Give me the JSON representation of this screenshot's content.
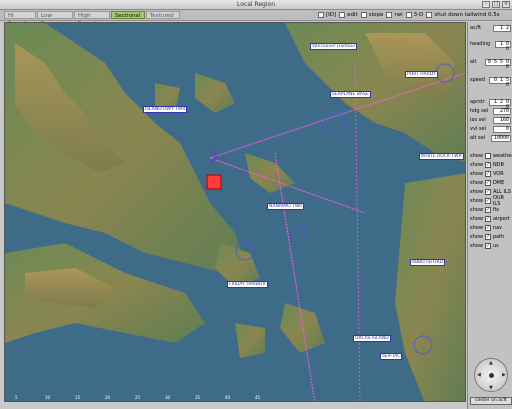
{
  "window": {
    "title": "Local Region"
  },
  "tabs": [
    {
      "label": "Hi Speed"
    },
    {
      "label": "Low Enroute"
    },
    {
      "label": "High Enroute"
    },
    {
      "label": "Sectional",
      "active": true
    },
    {
      "label": "Textured"
    }
  ],
  "toolbar_options": [
    {
      "label": "[ID]",
      "checked": false
    },
    {
      "label": "edit",
      "checked": false
    },
    {
      "label": "slope",
      "checked": false
    },
    {
      "label": "rwi",
      "checked": false
    },
    {
      "label": "3-D",
      "checked": false
    },
    {
      "label": "shut down tailwind 0.5s",
      "checked": false
    }
  ],
  "panel": {
    "zoom_label": "ac/ft",
    "zoom_value": "1 2",
    "heading_label": "heading",
    "heading_value": "1 0 0",
    "alt_label": "alt",
    "alt_value": "0 5 5 0 0",
    "speed_label": "speed",
    "speed_value": "0 1 5 0",
    "aprstr_label": "aprstr",
    "aprstr_value": "1 2 0 0",
    "hdgsel_label": "hdg sel",
    "hdgsel_value": "270",
    "iassel_label": "ias sel",
    "iassel_value": "160",
    "vvisel_label": "vvi sel",
    "vvisel_value": "0",
    "altsel_label": "alt sel",
    "altsel_value": "10000",
    "center_button": "center on acft",
    "show_items": [
      {
        "label": "weather",
        "checked": false
      },
      {
        "label": "NDB",
        "checked": true
      },
      {
        "label": "VOR",
        "checked": true
      },
      {
        "label": "DME",
        "checked": true
      },
      {
        "label": "ALL ILS",
        "checked": true
      },
      {
        "label": "OUR ILS",
        "checked": true
      },
      {
        "label": "fix",
        "checked": true
      },
      {
        "label": "airport",
        "checked": true
      },
      {
        "label": "nav",
        "checked": true
      },
      {
        "label": "path",
        "checked": true
      },
      {
        "label": "us",
        "checked": true
      }
    ],
    "show_prefix": "show"
  },
  "map": {
    "labels": [
      {
        "text": "ISLAND HWY TWR"
      },
      {
        "text": "NANAIMO TWR"
      },
      {
        "text": "Vancouver Harbour"
      },
      {
        "text": "SEAPLANE BASE"
      },
      {
        "text": "PORT HARDY"
      },
      {
        "text": "WHITE ROCK TWR"
      },
      {
        "text": "ABBOTSFORD"
      },
      {
        "text": "FRIDAY HARBOR"
      },
      {
        "text": "ORCAS ISLAND"
      },
      {
        "text": "SEA-TAC"
      }
    ],
    "colors": {
      "water": "#3e6c88",
      "land_low": "#5f7d53",
      "land_high": "#a48c4d",
      "route": "#ff5adc",
      "aircraft": "#ff3b3b"
    }
  }
}
